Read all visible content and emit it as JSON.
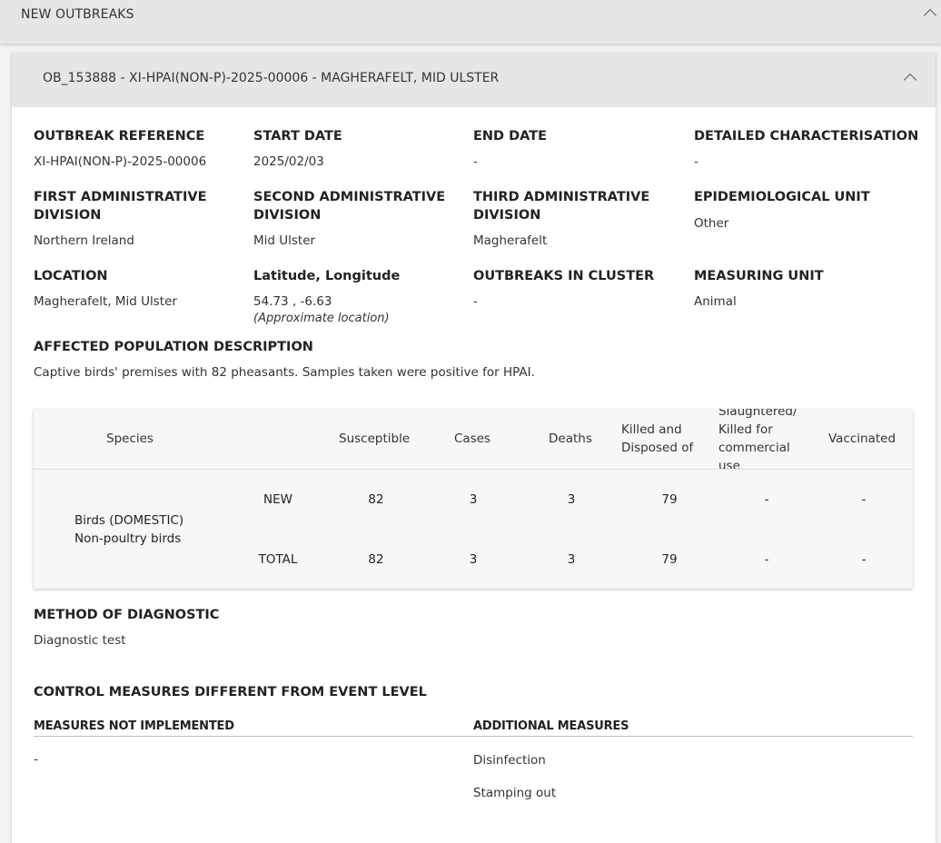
{
  "section_header": {
    "title": "NEW OUTBREAKS"
  },
  "outbreak": {
    "title": "OB_153888 - XI-HPAI(NON-P)-2025-00006 - MAGHERAFELT, MID ULSTER",
    "fields": {
      "outbreak_reference": {
        "label": "OUTBREAK REFERENCE",
        "value": "XI-HPAI(NON-P)-2025-00006"
      },
      "start_date": {
        "label": "START DATE",
        "value": "2025/02/03"
      },
      "end_date": {
        "label": "END DATE",
        "value": "-"
      },
      "detailed_characterisation": {
        "label": "DETAILED CHARACTERISATION",
        "value": "-"
      },
      "first_admin_division": {
        "label": "FIRST ADMINISTRATIVE DIVISION",
        "value": "Northern Ireland"
      },
      "second_admin_division": {
        "label": "SECOND ADMINISTRATIVE DIVISION",
        "value": "Mid Ulster"
      },
      "third_admin_division": {
        "label": "THIRD ADMINISTRATIVE DIVISION",
        "value": "Magherafelt"
      },
      "epidemiological_unit": {
        "label": "EPIDEMIOLOGICAL UNIT",
        "value": "Other"
      },
      "location": {
        "label": "LOCATION",
        "value": "Magherafelt, Mid Ulster"
      },
      "lat_long": {
        "label": "Latitude, Longitude",
        "value": "54.73 , -6.63",
        "note": "(Approximate location)"
      },
      "outbreaks_in_cluster": {
        "label": "OUTBREAKS IN CLUSTER",
        "value": "-"
      },
      "measuring_unit": {
        "label": "MEASURING UNIT",
        "value": "Animal"
      }
    },
    "affected_population": {
      "label": "AFFECTED POPULATION DESCRIPTION",
      "value": "Captive birds' premises with 82 pheasants. Samples taken were positive for HPAI."
    },
    "species_table": {
      "headers": {
        "species": "Species",
        "susceptible": "Susceptible",
        "cases": "Cases",
        "deaths": "Deaths",
        "killed_line1": "Killed and",
        "killed_line2": "Disposed of",
        "slaughtered_line1": "Slaughtered/",
        "slaughtered_line2": "Killed for",
        "slaughtered_line3": "commercial",
        "slaughtered_line4": "use",
        "vaccinated": "Vaccinated"
      },
      "species_line1": "Birds (DOMESTIC)",
      "species_line2": "Non-poultry birds",
      "rows": [
        {
          "type": "NEW",
          "susceptible": "82",
          "cases": "3",
          "deaths": "3",
          "killed": "79",
          "slaughtered": "-",
          "vaccinated": "-"
        },
        {
          "type": "TOTAL",
          "susceptible": "82",
          "cases": "3",
          "deaths": "3",
          "killed": "79",
          "slaughtered": "-",
          "vaccinated": "-"
        }
      ]
    },
    "method_of_diagnostic": {
      "label": "METHOD OF DIAGNOSTIC",
      "value": "Diagnostic test"
    },
    "control_measures": {
      "title": "CONTROL MEASURES DIFFERENT FROM EVENT LEVEL",
      "not_implemented_label": "MEASURES NOT IMPLEMENTED",
      "not_implemented_value": "-",
      "additional_label": "ADDITIONAL MEASURES",
      "additional_items": [
        "Disinfection",
        "Stamping out"
      ]
    }
  }
}
